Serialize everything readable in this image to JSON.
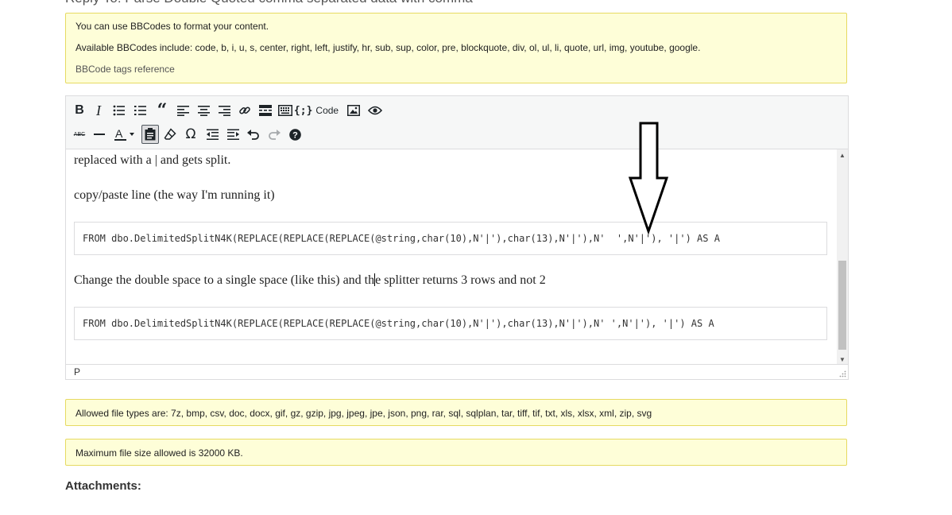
{
  "page": {
    "reply_heading": "Reply To: Parse Double Quoted comma separated data with comma"
  },
  "bbcode_notice": {
    "line1": "You can use BBCodes to format your content.",
    "line2": "Available BBCodes include: code, b, i, u, s, center, right, left, justify, hr, sub, sup, color, pre, blockquote, div, ol, ul, li, quote, url, img, youtube, google.",
    "reference_link": "BBCode tags reference"
  },
  "toolbar": {
    "row1": [
      "bold-icon",
      "italic-icon",
      "bullet-list-icon",
      "numbered-list-icon",
      "blockquote-icon",
      "align-left-icon",
      "align-center-icon",
      "align-right-icon",
      "link-icon",
      "read-more-icon",
      "toolbar-toggle-icon",
      "code-icon",
      "image-icon",
      "preview-icon"
    ],
    "row2": [
      "strikethrough-icon",
      "horizontal-line-icon",
      "text-color-icon",
      "paste-as-text-icon",
      "clear-formatting-icon",
      "special-character-icon",
      "outdent-icon",
      "indent-icon",
      "undo-icon",
      "redo-icon",
      "help-icon"
    ],
    "code_label": "Code"
  },
  "editor": {
    "para1": "replaced with a | and gets split.",
    "para2": "copy/paste line (the way I'm running it)",
    "code1": "FROM dbo.DelimitedSplitN4K(REPLACE(REPLACE(REPLACE(@string,char(10),N'|'),char(13),N'|'),N'  ',N'|'), '|') AS A",
    "para3_before_caret": "Change the double space to a single space (like this) and th",
    "para3_after_caret": "e splitter returns 3 rows and not 2",
    "code2": "FROM dbo.DelimitedSplitN4K(REPLACE(REPLACE(REPLACE(@string,char(10),N'|'),char(13),N'|'),N' ',N'|'), '|') AS A",
    "status_path": "P"
  },
  "file_types_notice": {
    "text": "Allowed file types are: 7z, bmp, csv, doc, docx, gif, gz, gzip, jpg, jpeg, jpe, json, png, rar, sql, sqlplan, tar, tiff, tif, txt, xls, xlsx, xml, zip, svg"
  },
  "file_size_notice": {
    "text": "Maximum file size allowed is 32000 KB."
  },
  "attachments": {
    "heading": "Attachments:"
  },
  "colors": {
    "notice_bg": "#fefed8",
    "notice_border": "#e6da62",
    "toolbar_bg": "#f6f7f7",
    "border": "#dcdcde"
  }
}
